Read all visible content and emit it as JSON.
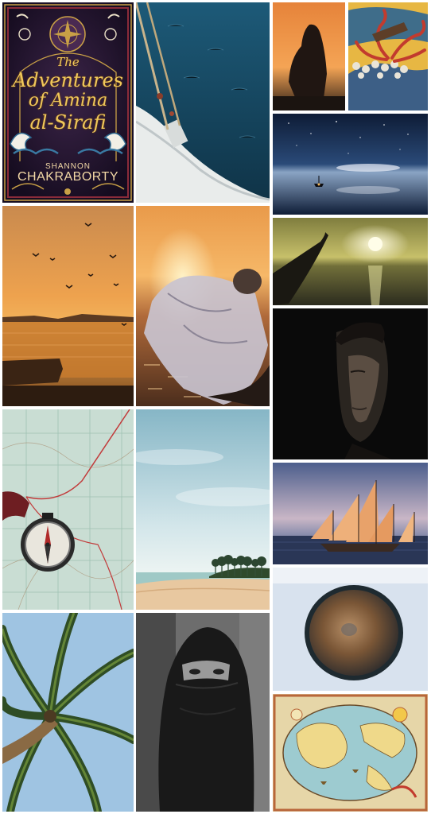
{
  "book_cover": {
    "title_line_1": "The",
    "title_line_2": "Adventures",
    "title_line_3": "of Amina",
    "title_line_4": "al-Sirafi",
    "author_first": "SHANNON",
    "author_last": "CHAKRABORTY"
  },
  "colors": {
    "cover_background": "#2a1836",
    "cover_gold": "#f0c85a",
    "sunset_orange": "#e58b34",
    "sea_blue": "#1f4a66"
  }
}
